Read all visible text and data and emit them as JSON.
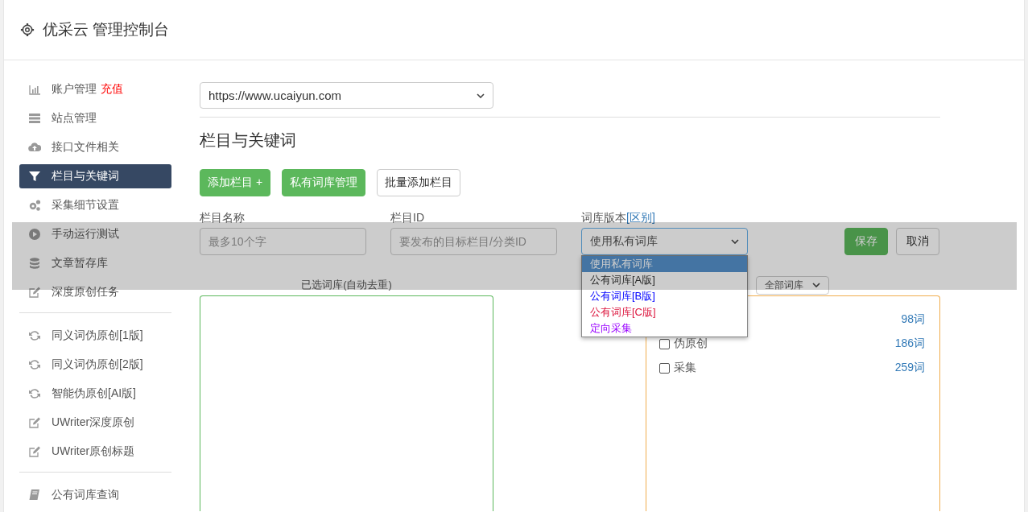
{
  "header": {
    "title": "优采云 管理控制台"
  },
  "sidebar": {
    "groups": [
      [
        {
          "label": "账户管理",
          "badge": "充值",
          "selected": false
        },
        {
          "label": "站点管理",
          "selected": false
        },
        {
          "label": "接口文件相关",
          "selected": false
        },
        {
          "label": "栏目与关键词",
          "selected": true
        },
        {
          "label": "采集细节设置",
          "selected": false
        },
        {
          "label": "手动运行测试",
          "selected": false
        },
        {
          "label": "文章暂存库",
          "selected": false
        },
        {
          "label": "深度原创任务",
          "selected": false
        }
      ],
      [
        {
          "label": "同义词伪原创[1版]",
          "selected": false
        },
        {
          "label": "同义词伪原创[2版]",
          "selected": false
        },
        {
          "label": "智能伪原创[AI版]",
          "selected": false
        },
        {
          "label": "UWriter深度原创",
          "selected": false
        },
        {
          "label": "UWriter原创标题",
          "selected": false
        }
      ],
      [
        {
          "label": "公有词库查询",
          "selected": false
        }
      ]
    ]
  },
  "site_select": {
    "value": "https://www.ucaiyun.com"
  },
  "section_title": "栏目与关键词",
  "actions": [
    {
      "label": "添加栏目 +",
      "kind": "primary"
    },
    {
      "label": "私有词库管理",
      "kind": "primary"
    },
    {
      "label": "批量添加栏目",
      "kind": "default"
    }
  ],
  "form": {
    "fields": [
      {
        "label": "栏目名称",
        "kind": "input",
        "placeholder": "最多10个字"
      },
      {
        "label": "栏目ID",
        "kind": "input",
        "placeholder": "要发布的目标栏目/分类ID"
      },
      {
        "label": "词库版本",
        "link": "[区别]",
        "kind": "select",
        "value": "使用私有词库"
      }
    ],
    "buttons": [
      {
        "label": "保存",
        "kind": "primary"
      },
      {
        "label": "取消",
        "kind": "default"
      }
    ]
  },
  "dropdown": [
    {
      "label": "使用私有词库",
      "selected": true
    },
    {
      "label": "公有词库[A版]",
      "selected": false
    },
    {
      "label": "公有词库[B版]",
      "selected": false,
      "color": "#0000ff"
    },
    {
      "label": "公有词库[C版]",
      "selected": false,
      "color": "#dc143c"
    },
    {
      "label": "定向采集",
      "selected": false,
      "color": "#9900ff"
    }
  ],
  "selected_panel": {
    "title": "已选词库(自动去重)"
  },
  "library_panel": {
    "filter": "全部词库",
    "rows": [
      {
        "count": "98词"
      },
      {
        "label": "伪原创",
        "count": "186词",
        "checked": false
      },
      {
        "label": "采集",
        "count": "259词",
        "checked": false
      }
    ]
  }
}
